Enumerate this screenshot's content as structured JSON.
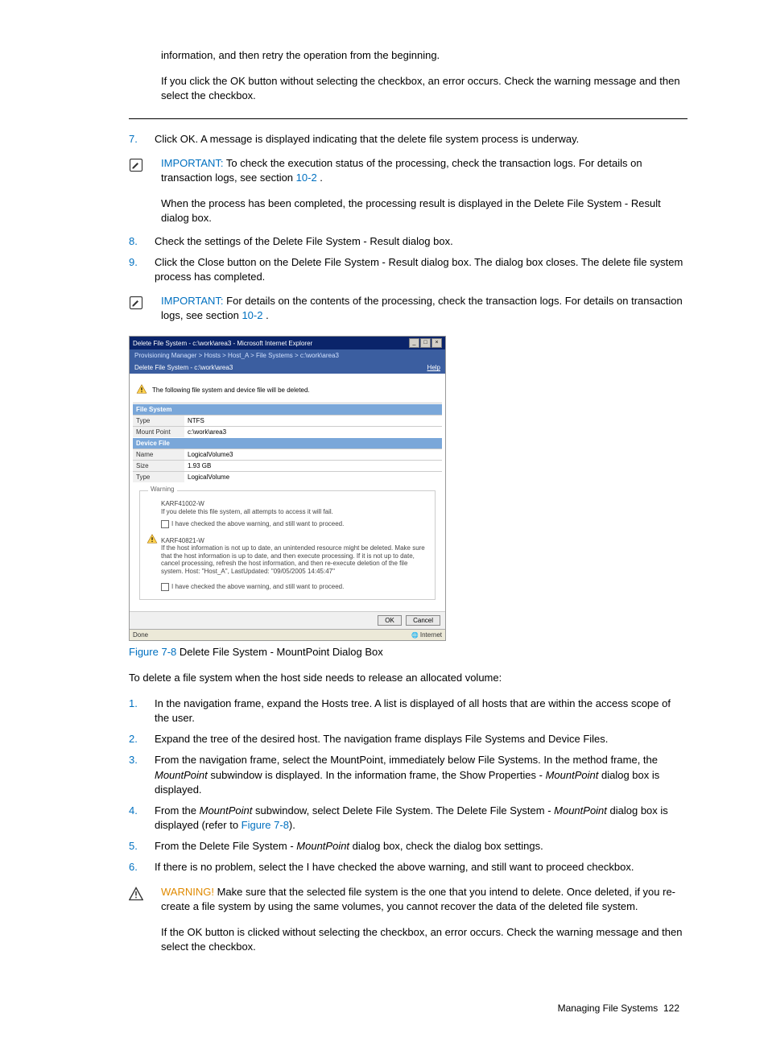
{
  "intro": {
    "p1": "information, and then retry the operation from the beginning.",
    "p2": "If you click the OK button without selecting the checkbox, an error occurs. Check the warning message and then select the checkbox."
  },
  "steps_a": {
    "s7_num": "7.",
    "s7": "Click OK. A message is displayed indicating that the delete file system process is underway.",
    "s8_num": "8.",
    "s8": "Check the settings of the Delete File System - Result dialog box.",
    "s9_num": "9.",
    "s9": "Click the Close button on the Delete File System - Result dialog box. The dialog box closes. The delete file system process has completed."
  },
  "imp1": {
    "label": "IMPORTANT:",
    "body_a": " To check the execution status of the processing, check the transaction logs. For details on transaction logs, see section ",
    "link": "10-2",
    "period": " ."
  },
  "imp1_follow": "When the process has been completed, the processing result is displayed in the Delete File System - Result dialog box.",
  "imp2": {
    "label": "IMPORTANT:",
    "body_a": " For details on the contents of the processing, check the transaction logs. For details on transaction logs, see section ",
    "link": "10-2",
    "period": " ."
  },
  "shot": {
    "title": "Delete File System - c:\\work\\area3 - Microsoft Internet Explorer",
    "crumbs": "Provisioning Manager > Hosts > Host_A > File Systems > c:\\work\\area3",
    "subtitle": "Delete File System - c:\\work\\area3",
    "help": "Help",
    "topwarn": "The following file system and device file will be deleted.",
    "section_fs": "File System",
    "fs_type_lbl": "Type",
    "fs_type": "NTFS",
    "fs_mp_lbl": "Mount Point",
    "fs_mp": "c:\\work\\area3",
    "section_df": "Device File",
    "df_name_lbl": "Name",
    "df_name": "LogicalVolume3",
    "df_size_lbl": "Size",
    "df_size": "1.93 GB",
    "df_type_lbl": "Type",
    "df_type": "LogicalVolume",
    "warn_legend": "Warning",
    "w1_code": "KARF41002-W",
    "w1_msg": "If you delete this file system, all attempts to access it will fail.",
    "cb_text": "I have checked the above warning, and still want to proceed.",
    "w2_code": "KARF40821-W",
    "w2_msg": "If the host information is not up to date, an unintended resource might be deleted. Make sure that the host information is up to date, and then execute processing. If it is not up to date, cancel processing, refresh the host information, and then re-execute deletion of the file system. Host: \"Host_A\", LastUpdated: \"09/05/2005 14:45:47\"",
    "ok": "OK",
    "cancel": "Cancel",
    "done": "Done",
    "net": "Internet"
  },
  "figcap": {
    "num": "Figure 7-8",
    "text": " Delete File System - MountPoint Dialog Box"
  },
  "lead": "To delete a file system when the host side needs to release an allocated volume:",
  "steps_b": {
    "s1_num": "1.",
    "s1": "In the navigation frame, expand the Hosts tree. A list is displayed of all hosts that are within the access scope of the user.",
    "s2_num": "2.",
    "s2": "Expand the tree of the desired host. The navigation frame displays File Systems and Device Files.",
    "s3_num": "3.",
    "s3_a": "From the navigation frame, select the MountPoint, immediately below File Systems. In the method frame, the ",
    "s3_i1": "MountPoint",
    "s3_b": " subwindow is displayed. In the information frame, the Show Properties - ",
    "s3_i2": "MountPoint",
    "s3_c": " dialog box is displayed.",
    "s4_num": "4.",
    "s4_a": "From the ",
    "s4_i1": "MountPoint",
    "s4_b": " subwindow, select Delete File System. The Delete File System - ",
    "s4_i2": "MountPoint",
    "s4_c": " dialog box is displayed (refer to ",
    "s4_link": "Figure 7-8",
    "s4_d": ").",
    "s5_num": "5.",
    "s5_a": "From the Delete File System - ",
    "s5_i1": "MountPoint",
    "s5_b": " dialog box, check the dialog box settings.",
    "s6_num": "6.",
    "s6": "If there is no problem, select the I have checked the above warning, and still want to proceed checkbox."
  },
  "warn": {
    "label": "WARNING!",
    "body": " Make sure that the selected file system is the one that you intend to delete. Once deleted, if you re-create a file system by using the same volumes, you cannot recover the data of the deleted file system.",
    "follow": "If the OK button is clicked without selecting the checkbox, an error occurs. Check the warning message and then select the checkbox."
  },
  "footer": {
    "text": "Managing File Systems",
    "num": "122"
  }
}
